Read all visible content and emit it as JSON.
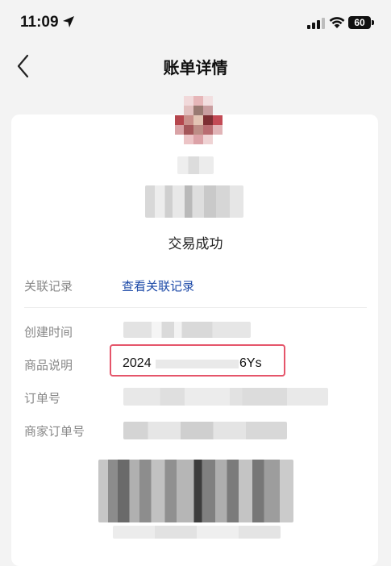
{
  "status_bar": {
    "time": "11:09",
    "battery": "60",
    "icons": [
      "location-arrow-icon",
      "cellular-signal-icon",
      "wifi-icon",
      "battery-icon"
    ]
  },
  "nav": {
    "title": "账单详情",
    "back_icon": "chevron-left-icon"
  },
  "transaction": {
    "status": "交易成功"
  },
  "rows": {
    "related_label": "关联记录",
    "related_link": "查看关联记录",
    "created_label": "创建时间",
    "desc_label": "商品说明",
    "desc_value_start": "2024",
    "desc_value_end": "6Ys",
    "order_label": "订单号",
    "merchant_order_label": "商家订单号"
  },
  "colors": {
    "link": "#1d4aa8",
    "highlight": "#e5556a",
    "background": "#f3f3f3"
  }
}
